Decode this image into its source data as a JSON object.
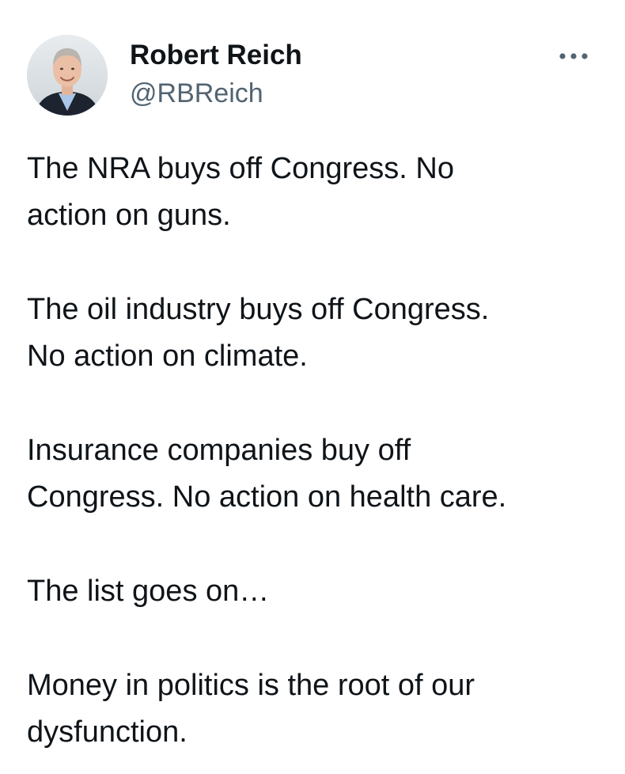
{
  "author": {
    "display_name": "Robert Reich",
    "handle": "@RBReich",
    "avatar_icon": "profile-photo"
  },
  "menu": {
    "more_icon": "more-horizontal-icon"
  },
  "tweet": {
    "paragraphs": [
      "The NRA buys off Congress. No\naction on guns.",
      "The oil industry buys off Congress.\nNo action on climate.",
      "Insurance companies buy off\nCongress. No action on health care.",
      "The list goes on…",
      "Money in politics is the root of our\ndysfunction."
    ]
  },
  "colors": {
    "text_primary": "#0f1419",
    "text_secondary": "#536471",
    "background": "#ffffff"
  }
}
